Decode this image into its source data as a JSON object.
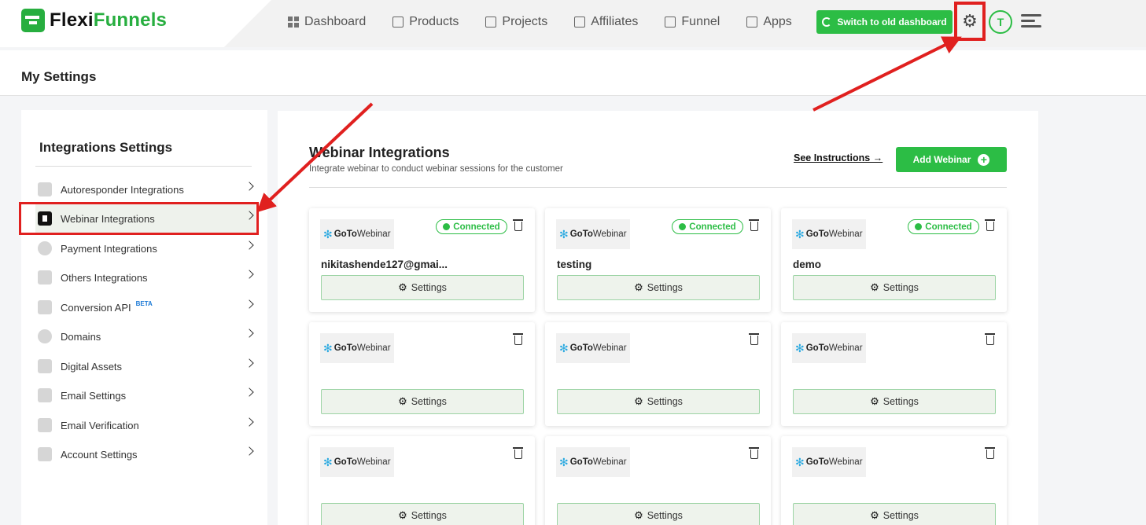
{
  "brand": {
    "name_part1": "Flexi",
    "name_part2": "Funnels"
  },
  "nav": [
    {
      "label": "Dashboard",
      "icon": "grid-icon"
    },
    {
      "label": "Products",
      "icon": "store-icon"
    },
    {
      "label": "Projects",
      "icon": "document-icon"
    },
    {
      "label": "Affiliates",
      "icon": "handshake-icon"
    },
    {
      "label": "Funnel",
      "icon": "funnel-icon"
    },
    {
      "label": "Apps",
      "icon": "shop-icon"
    }
  ],
  "header": {
    "old_dashboard_label": "Switch to old dashboard",
    "avatar_initial": "T"
  },
  "page": {
    "title": "My Settings"
  },
  "sidebar": {
    "title": "Integrations Settings",
    "items": [
      {
        "label": "Autoresponder Integrations",
        "icon": "user-icon"
      },
      {
        "label": "Webinar Integrations",
        "icon": "play-icon",
        "active": true
      },
      {
        "label": "Payment Integrations",
        "icon": "dollar-icon"
      },
      {
        "label": "Others Integrations",
        "icon": "file-icon"
      },
      {
        "label": "Conversion API",
        "icon": "code-icon",
        "badge": "BETA"
      },
      {
        "label": "Domains",
        "icon": "globe-icon"
      },
      {
        "label": "Digital Assets",
        "icon": "gift-icon"
      },
      {
        "label": "Email Settings",
        "icon": "mail-icon"
      },
      {
        "label": "Email Verification",
        "icon": "verify-icon"
      },
      {
        "label": "Account Settings",
        "icon": "gear-icon"
      }
    ]
  },
  "main": {
    "title": "Webinar Integrations",
    "subtitle": "Integrate webinar to conduct webinar sessions for the customer",
    "see_instructions": "See Instructions →",
    "add_webinar": "Add Webinar",
    "logo_text_bold": "GoTo",
    "logo_text_rest": "Webinar",
    "connected_label": "Connected",
    "settings_label": "Settings",
    "cards": [
      {
        "name": "nikitashende127@gmai...",
        "connected": true
      },
      {
        "name": "testing",
        "connected": true
      },
      {
        "name": "demo",
        "connected": true
      },
      {
        "name": "",
        "connected": false
      },
      {
        "name": "",
        "connected": false
      },
      {
        "name": "",
        "connected": false
      },
      {
        "name": "",
        "connected": false
      },
      {
        "name": "",
        "connected": false
      },
      {
        "name": "",
        "connected": false
      }
    ]
  },
  "colors": {
    "accent": "#2cbd45",
    "annotation": "#e0201f"
  }
}
